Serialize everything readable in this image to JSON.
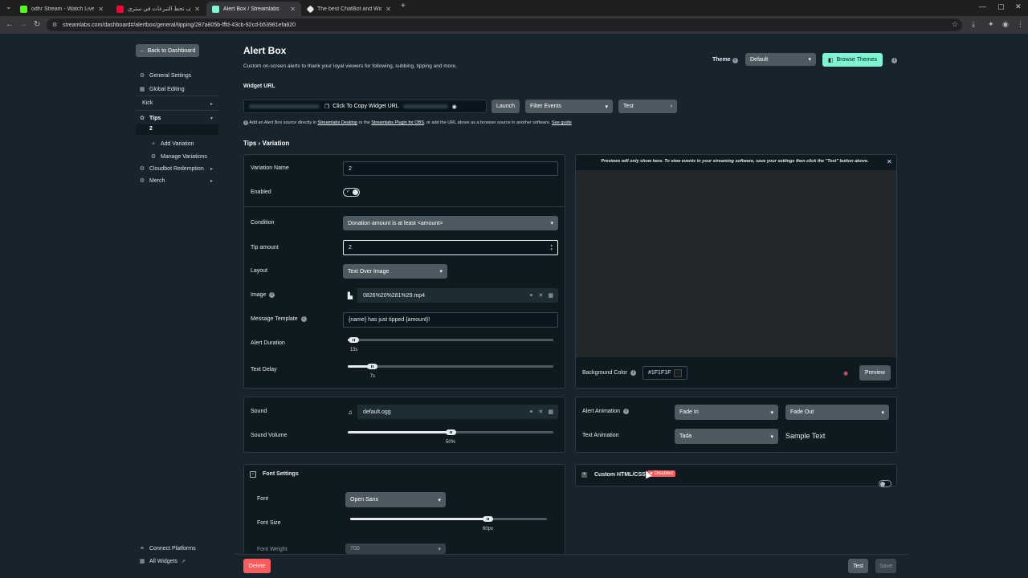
{
  "browser": {
    "tabs": [
      {
        "title": "odhr Stream - Watch Live on K",
        "color": "#53fc18"
      },
      {
        "title": "شرح كيف تحط التبرعات في ستري",
        "color": "#ff0033"
      },
      {
        "title": "Alert Box / Streamlabs",
        "color": "#80f5d2"
      },
      {
        "title": "The best ChatBot and Widgets",
        "color": "#e8e8e8"
      }
    ],
    "new_tab": "+",
    "url": "streamlabs.com/dashboard#/alertbox/general/tipping/287a805b-fffd-43cb-92cd-b53981efa820"
  },
  "sidebar": {
    "back_label": "Back to Dashboard",
    "items": [
      {
        "label": "General Settings",
        "icon": "gear-icon"
      },
      {
        "label": "Global Editing",
        "icon": "grid-icon"
      },
      {
        "label": "Kick"
      },
      {
        "label": "Tips",
        "icon": "tips-icon"
      },
      {
        "label": "2"
      },
      {
        "label": "Add Variation",
        "icon": "plus-icon"
      },
      {
        "label": "Manage Variations",
        "icon": "gear-icon"
      },
      {
        "label": "Cloudbot Redemption",
        "icon": "cloudbot-icon"
      },
      {
        "label": "Merch",
        "icon": "merch-icon"
      }
    ],
    "connect_platforms": "Connect Platforms",
    "all_widgets": "All Widgets"
  },
  "header": {
    "title": "Alert Box",
    "subtitle": "Custom on-screen alerts to thank your loyal viewers for following, subbing, tipping and more.",
    "theme_label": "Theme",
    "theme_value": "Default",
    "browse_themes": "Browse Themes"
  },
  "widget_url": {
    "label": "Widget URL",
    "copy_label": "Click To Copy Widget URL",
    "launch": "Launch",
    "filter_events": "Filter Events",
    "test": "Test",
    "note_prefix": "Add an Alert Box source directly in",
    "note_link1": "Streamlabs Desktop",
    "note_mid": "or the",
    "note_link2": "Streamlabs Plugin for OBS",
    "note_suffix": ", or add the URL above as a browser source in another software.",
    "note_link3": "See guide"
  },
  "breadcrumb": {
    "parent": "Tips",
    "sep": "›",
    "current": "Variation"
  },
  "variation": {
    "name_label": "Variation Name",
    "name_value": "2",
    "enabled_label": "Enabled",
    "enabled": true,
    "condition_label": "Condition",
    "condition_value": "Donation amount is at least <amount>",
    "tip_amount_label": "Tip amount",
    "tip_amount_value": "2",
    "layout_label": "Layout",
    "layout_value": "Text Over Image",
    "image_label": "Image",
    "image_file": "0826%20%281%29.mp4",
    "message_template_label": "Message Template",
    "message_template_value": "{name} has just tipped {amount}!",
    "alert_duration_label": "Alert Duration",
    "alert_duration_value": "13s",
    "alert_duration_fraction": 0.03,
    "text_delay_label": "Text Delay",
    "text_delay_value": "7s",
    "text_delay_fraction": 0.12
  },
  "preview": {
    "notice": "Previews will only show here. To view events in your streaming software, save your settings then click the \"Test\" button above.",
    "bg_color_label": "Background Color",
    "bg_color_value": "#1F1F1F",
    "preview_button": "Preview"
  },
  "sound": {
    "label": "Sound",
    "file": "default.ogg",
    "volume_label": "Sound Volume",
    "volume_value": "50%",
    "volume_fraction": 0.5
  },
  "animation": {
    "alert_label": "Alert Animation",
    "alert_in": "Fade In",
    "alert_out": "Fade Out",
    "text_label": "Text Animation",
    "text_value": "Tada",
    "sample_text": "Sample Text"
  },
  "font_settings": {
    "title": "Font Settings",
    "font_label": "Font",
    "font_value": "Open Sans",
    "size_label": "Font Size",
    "size_value": "60px",
    "size_fraction": 0.7,
    "weight_label": "Font Weight",
    "weight_value": "700"
  },
  "custom_html": {
    "label": "Custom HTML/CSS",
    "badge": "Disabled"
  },
  "footer": {
    "delete": "Delete",
    "test": "Test",
    "save": "Save"
  },
  "colors": {
    "accent": "#80f5d2",
    "danger": "#f85c5c",
    "background": "#17242d"
  }
}
